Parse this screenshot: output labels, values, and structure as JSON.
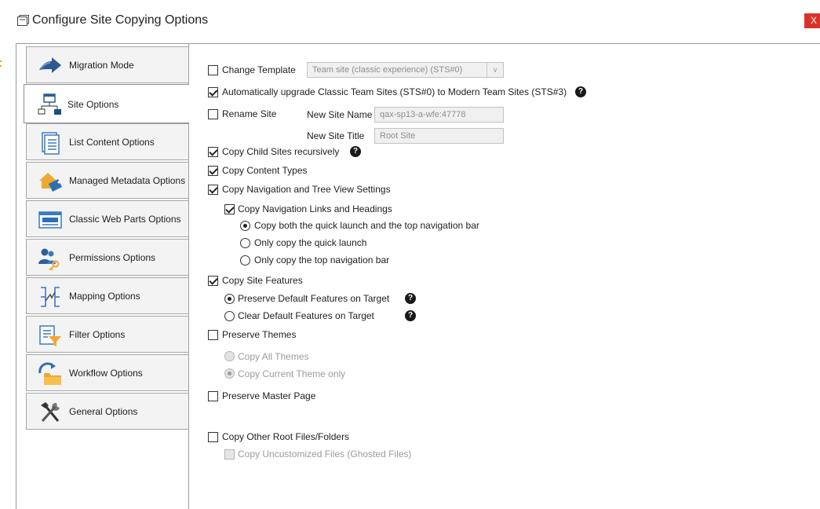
{
  "window": {
    "title": "Configure Site Copying Options",
    "close_glyph": "X"
  },
  "sidebar": {
    "items": [
      {
        "label": "Migration Mode",
        "icon": "migration-arrow-icon"
      },
      {
        "label": "Site Options",
        "icon": "site-tree-icon",
        "active": true
      },
      {
        "label": "List Content Options",
        "icon": "list-document-icon"
      },
      {
        "label": "Managed Metadata Options",
        "icon": "metadata-tag-icon"
      },
      {
        "label": "Classic Web Parts Options",
        "icon": "web-part-icon"
      },
      {
        "label": "Permissions Options",
        "icon": "users-key-icon"
      },
      {
        "label": "Mapping Options",
        "icon": "mapping-icon"
      },
      {
        "label": "Filter Options",
        "icon": "filter-document-icon"
      },
      {
        "label": "Workflow Options",
        "icon": "workflow-folder-icon"
      },
      {
        "label": "General Options",
        "icon": "tools-icon"
      }
    ]
  },
  "options": {
    "change_template": {
      "label": "Change Template",
      "checked": false,
      "dropdown_value": "Team site (classic experience) (STS#0)"
    },
    "auto_upgrade": {
      "label": "Automatically upgrade Classic Team Sites (STS#0) to Modern Team Sites (STS#3)",
      "checked": true
    },
    "rename_site": {
      "label": "Rename Site",
      "checked": false,
      "new_site_name_label": "New Site Name",
      "new_site_name_value": "qax-sp13-a-wfe:47778",
      "new_site_title_label": "New Site Title",
      "new_site_title_value": "Root Site"
    },
    "copy_child_sites": {
      "label": "Copy Child Sites recursively",
      "checked": true
    },
    "copy_content_types": {
      "label": "Copy Content Types",
      "checked": true
    },
    "copy_navigation": {
      "label": "Copy Navigation and Tree View Settings",
      "checked": true
    },
    "copy_nav_links": {
      "label": "Copy Navigation Links and Headings",
      "checked": true
    },
    "nav_radio": [
      {
        "label": "Copy both the quick launch and the top navigation bar",
        "selected": true
      },
      {
        "label": "Only copy the quick launch",
        "selected": false
      },
      {
        "label": "Only copy the top navigation bar",
        "selected": false
      }
    ],
    "copy_site_features": {
      "label": "Copy Site Features",
      "checked": true
    },
    "features_radio": [
      {
        "label": "Preserve Default Features on Target",
        "selected": true
      },
      {
        "label": "Clear Default Features on Target",
        "selected": false
      }
    ],
    "preserve_themes": {
      "label": "Preserve Themes",
      "checked": false
    },
    "themes_radio": [
      {
        "label": "Copy All Themes",
        "selected": false
      },
      {
        "label": "Copy Current Theme only",
        "selected": true
      }
    ],
    "preserve_master_page": {
      "label": "Preserve Master Page",
      "checked": false
    },
    "copy_other_root_files": {
      "label": "Copy Other Root Files/Folders",
      "checked": false
    },
    "copy_uncustomized_files": {
      "label": "Copy Uncustomized Files (Ghosted Files)",
      "checked": false
    },
    "help_glyph": "?"
  },
  "colors": {
    "close_button": "#d9332c",
    "help_icon": "#1a1a1a",
    "disabled_text": "#9c9c9c"
  }
}
